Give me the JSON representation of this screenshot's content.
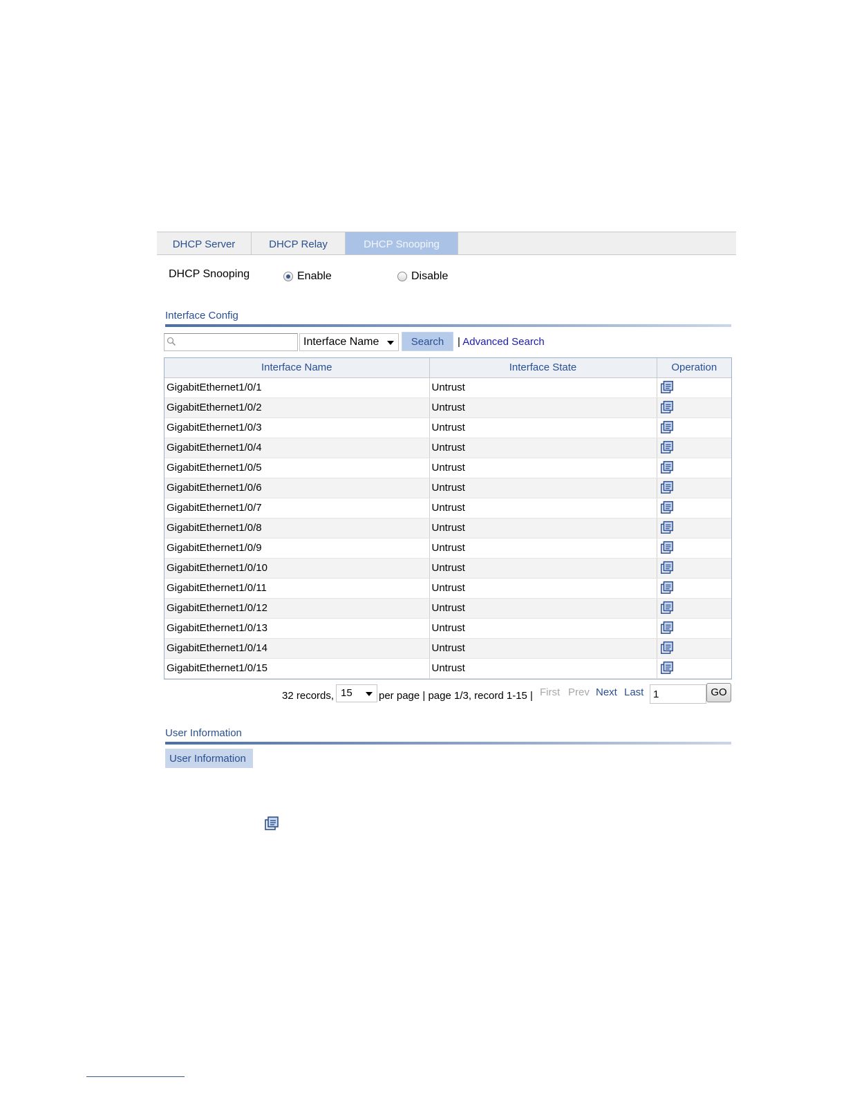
{
  "tabs": [
    {
      "label": "DHCP Server"
    },
    {
      "label": "DHCP Relay"
    },
    {
      "label": "DHCP Snooping"
    }
  ],
  "snooping": {
    "label": "DHCP Snooping",
    "enable_label": "Enable",
    "disable_label": "Disable",
    "selected": "Enable"
  },
  "interface_config": {
    "title": "Interface Config",
    "search": {
      "value": "",
      "field_selected": "Interface Name",
      "search_label": "Search",
      "separator": "|",
      "advanced_label": "Advanced Search"
    },
    "columns": [
      "Interface Name",
      "Interface State",
      "Operation"
    ],
    "rows": [
      {
        "name": "GigabitEthernet1/0/1",
        "state": "Untrust",
        "op_icon": "edit-icon"
      },
      {
        "name": "GigabitEthernet1/0/2",
        "state": "Untrust",
        "op_icon": "edit-icon"
      },
      {
        "name": "GigabitEthernet1/0/3",
        "state": "Untrust",
        "op_icon": "edit-icon"
      },
      {
        "name": "GigabitEthernet1/0/4",
        "state": "Untrust",
        "op_icon": "edit-icon"
      },
      {
        "name": "GigabitEthernet1/0/5",
        "state": "Untrust",
        "op_icon": "edit-icon"
      },
      {
        "name": "GigabitEthernet1/0/6",
        "state": "Untrust",
        "op_icon": "edit-icon"
      },
      {
        "name": "GigabitEthernet1/0/7",
        "state": "Untrust",
        "op_icon": "edit-icon"
      },
      {
        "name": "GigabitEthernet1/0/8",
        "state": "Untrust",
        "op_icon": "edit-icon"
      },
      {
        "name": "GigabitEthernet1/0/9",
        "state": "Untrust",
        "op_icon": "edit-icon"
      },
      {
        "name": "GigabitEthernet1/0/10",
        "state": "Untrust",
        "op_icon": "edit-icon"
      },
      {
        "name": "GigabitEthernet1/0/11",
        "state": "Untrust",
        "op_icon": "edit-icon"
      },
      {
        "name": "GigabitEthernet1/0/12",
        "state": "Untrust",
        "op_icon": "edit-icon"
      },
      {
        "name": "GigabitEthernet1/0/13",
        "state": "Untrust",
        "op_icon": "edit-icon"
      },
      {
        "name": "GigabitEthernet1/0/14",
        "state": "Untrust",
        "op_icon": "edit-icon"
      },
      {
        "name": "GigabitEthernet1/0/15",
        "state": "Untrust",
        "op_icon": "edit-icon"
      }
    ],
    "pagination": {
      "records_text": "32 records,",
      "per_page_value": "15",
      "summary_text": "per page | page 1/3, record 1-15 |",
      "first_label": "First",
      "prev_label": "Prev",
      "next_label": "Next",
      "last_label": "Last",
      "page_input_value": "1",
      "go_label": "GO"
    }
  },
  "user_information": {
    "title": "User Information",
    "button_label": "User Information"
  },
  "colors": {
    "link_blue": "#2a4f8f",
    "active_tab": "#a9c2e6",
    "advanced_search_link": "#1a1ab5"
  }
}
